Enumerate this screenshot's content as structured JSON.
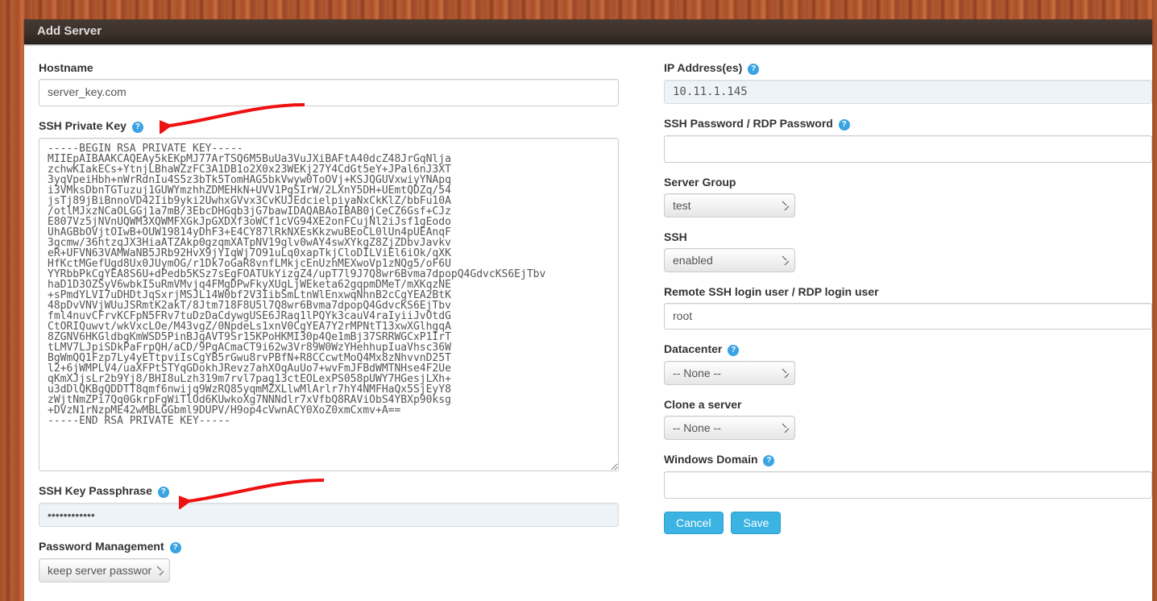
{
  "title_bar": "Add Server",
  "left": {
    "hostname_label": "Hostname",
    "hostname_value": "server_key.com",
    "ssh_key_label": "SSH Private Key",
    "ssh_key_value": "-----BEGIN RSA PRIVATE KEY-----\nMIIEpAIBAAKCAQEAy5kEKpMJ77ArTSQ6M5BuUa3VuJXiBAFtA40dcZ48JrGqNlja\nzchwKIakECs+YtnjLBhaWZzFC3A1DB1o2X0x23WEKj27Y4CdGt5eY+JPal6nJ3XT\n3yqVpeiHbh+nWrRdnIu4S5z3bTk5TomHAG5bkVwyw0ToOVj+KSJQGUVxwiyYNApq\ni3VMksDbnTGTuzuj1GUWYmzhhZDMEHkN+UVV1PgSIrW/2LXnY5DH+UEmtQDZq/54\njsTj89jBiBnnoVD42Iib9yki2UwhxGVvx3CvKUJEdcielpiyaNxCkKlZ/bbFu10A\n/otlMJxzNCaOLGGj1a7mB/3EbcDHGqb3jG7bawIDAQABAoIBAB0jCeCZ6Gsf+CJz\nE807Vz5jNVnUQWM3XQWMFXGkJpGXDXf3oWCf1cVG94XE2onFCujNl2iJsf1gEodo\nUhAGBbOVjtOIwB+OUW19814yDhF3+E4CY87lRkNXEsKkzwuBEoCL0lUn4pUEAnqF\n3gcmw/36htzqJX3HiaATZAkp0gzqmXATpNV19glv0wAY4swXYkgZ8ZjZDbvJavkv\neR+UFVN63VAMWaNB5JRb92HvX9jYIqWj7O91uLq0xapTkjCloDILViEl6iOk/qXK\nHfKctMGefUgd8Ux0JUymOG/r1Dk7oGaR8vnfLMkjcEnUzhMEXwoVp1zNQg5/oF6U\nYYRbbPkCgYEA8S6U+dPedb5KSz7sEgFOATUkYizgZ4/upT7l9J7Q8wr6Bvma7dpopQ4GdvcKS6EjTbv\nhaD1D3OZSyV6wbkI5uRmVMvjq4FMgDPwFkyXUgLjWEketa62gqpmDMeT/mXKqzNE\n+sPmdYLVI7uDHDtJqSxrjMSJL14W0bf2V3IibSmLtnWlEnxwqNhnB2cCgYEA2BtK\n48pDvVNVjWUuJSRmtK2akT/8Jtm718F8U5l7Q8wr6Bvma7dpopQ4GdvcKS6EjTbv\nfml4nuvCFrvKCFpN5FRv7tuDzDaCdywgUSE6JRaq1lPQYk3cauV4raIyiiJvOtdG\nCtORIQuwvt/wkVxcLOe/M43vgZ/0NpdeLs1xnV0CgYEA7Y2rMPNtT13xwXGlhgqA\n8ZGNV6HKGldbgKmWSD5PinBJgAVT9Sr15KPoHKMI30p4Qe1mBj37SRRWGCxP1IrT\ntLMV7LJpiSDkPaFrpQH/aCD/9PgACmaCT9i62w3Vr89W0WzYHehhupIuaVhsc36W\nBgWmQQ1Fzp7Ly4yETtpviIsCgYB5rGwu8rvPBfN+R8CCcwtMoQ4Mx8zNhvvnD25T\nl2+6jWMPLV4/uaXFPtSTYqGDokhJRevz7ahXOqAuUo7+wvFmJFBdWMTNHse4F2Ue\nqKmXJjsLr2b9Yj8/BHI8uLzh319m7rvl7pag13ctEOLexPS058pUWY7HGesjLXh+\nu3dDlQKBgQDDTT8qmf6nwijq9WzRQ85yqmMZXLlwMlArlr7hY4NMFHaQx5SjEyY8\nzWjtNmZPi7Qq0GkrpFgWiTlOd6KUwkoXg7NNNdlr7xVfbQ8RAViObS4YBXp90ksg\n+DVzN1rNzpME42wMBLGGbml9DUPV/H9op4cVwnACY0XoZ0xmCxmv+A==\n-----END RSA PRIVATE KEY-----",
    "passphrase_label": "SSH Key Passphrase",
    "passphrase_display": "••••••••••••",
    "pwmgmt_label": "Password Management",
    "pwmgmt_options": [
      "keep server password"
    ],
    "pwmgmt_selected": "keep server password"
  },
  "right": {
    "ip_label": "IP Address(es)",
    "ip_value": "10.11.1.145",
    "sshpw_label": "SSH Password / RDP Password",
    "sshpw_value": "",
    "group_label": "Server Group",
    "group_options": [
      "test"
    ],
    "group_selected": "test",
    "ssh_label": "SSH",
    "ssh_options": [
      "enabled"
    ],
    "ssh_selected": "enabled",
    "loginuser_label": "Remote SSH login user / RDP login user",
    "loginuser_value": "root",
    "dc_label": "Datacenter",
    "dc_options": [
      "-- None --"
    ],
    "dc_selected": "-- None --",
    "clone_label": "Clone a server",
    "clone_options": [
      "-- None --"
    ],
    "clone_selected": "-- None --",
    "windomain_label": "Windows Domain",
    "windomain_value": "",
    "cancel": "Cancel",
    "save": "Save"
  }
}
